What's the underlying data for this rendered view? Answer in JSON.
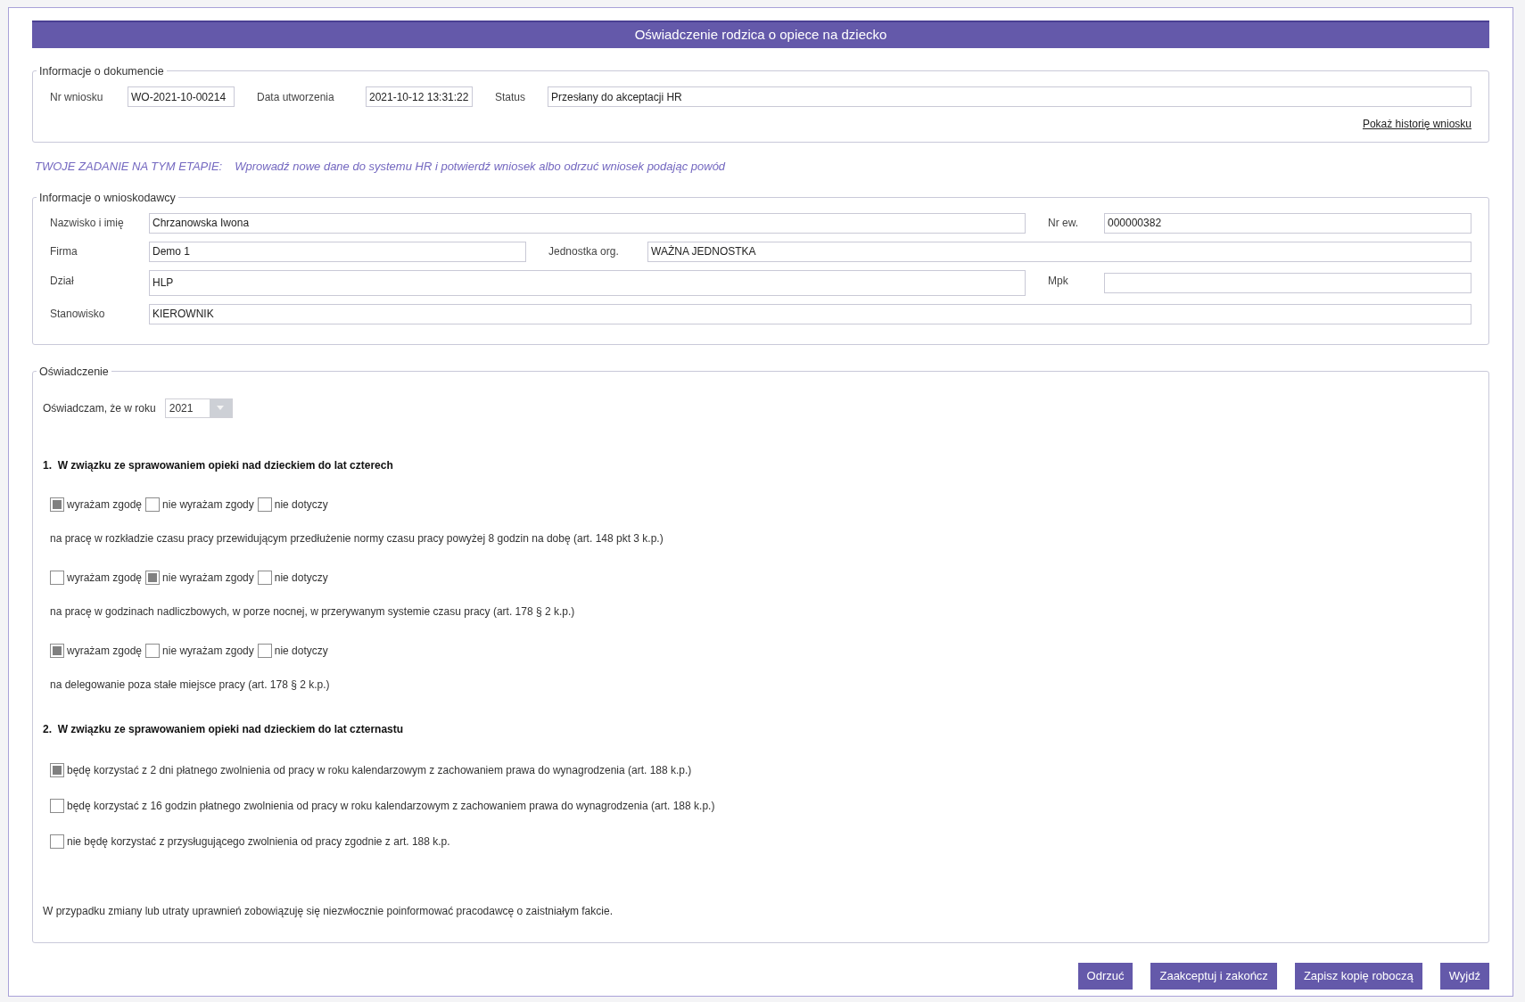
{
  "title": "Oświadczenie rodzica o opiece na dziecko",
  "document_info": {
    "legend": "Informacje o dokumencie",
    "fields": [
      {
        "label": "Nr wniosku",
        "value": "WO-2021-10-00214"
      },
      {
        "label": "Data utworzenia",
        "value": "2021-10-12 13:31:22"
      },
      {
        "label": "Status",
        "value": "Przesłany do akceptacji HR"
      }
    ],
    "history_link": "Pokaż historię wniosku"
  },
  "task": {
    "label": "TWOJE ZADANIE NA TYM ETAPIE:",
    "text": "Wprowadź nowe dane do systemu HR i potwierdź wniosek albo odrzuć wniosek podając powód"
  },
  "applicant": {
    "legend": "Informacje o wnioskodawcy",
    "fields": [
      {
        "label": "Nazwisko i imię",
        "value": "Chrzanowska Iwona"
      },
      {
        "label": "Nr ew.",
        "value": "000000382"
      },
      {
        "label": "Firma",
        "value": "Demo 1"
      },
      {
        "label": "Jednostka org.",
        "value": "WAŻNA JEDNOSTKA"
      },
      {
        "label": "Dział",
        "value": "HLP"
      },
      {
        "label": "Mpk"
      },
      {
        "label": "Stanowisko",
        "value": "KIEROWNIK"
      }
    ]
  },
  "declaration": {
    "legend": "Oświadczenie",
    "year_label": "Oświadczam, że w roku",
    "year": "2021",
    "section_1": {
      "heading": "1.  W związku ze sprawowaniem opieki nad dzieckiem do lat czterech",
      "items": [
        {
          "options": [
            {
              "label": "wyrażam zgodę",
              "checked": true
            },
            {
              "label": "nie wyrażam zgody",
              "checked": false
            },
            {
              "label": "nie dotyczy",
              "checked": false
            }
          ],
          "text": "na pracę w rozkładzie czasu pracy przewidującym przedłużenie normy czasu pracy powyżej 8 godzin na dobę (art. 148 pkt 3 k.p.)"
        },
        {
          "options": [
            {
              "label": "wyrażam zgodę",
              "checked": false
            },
            {
              "label": "nie wyrażam zgody",
              "checked": true
            },
            {
              "label": "nie dotyczy",
              "checked": false
            }
          ],
          "text": "na pracę w godzinach nadliczbowych, w porze nocnej, w przerywanym systemie czasu pracy (art. 178 § 2 k.p.)"
        },
        {
          "options": [
            {
              "label": "wyrażam zgodę",
              "checked": true
            },
            {
              "label": "nie wyrażam zgody",
              "checked": false
            },
            {
              "label": "nie dotyczy",
              "checked": false
            }
          ],
          "text": "na delegowanie poza stałe miejsce pracy (art. 178 § 2 k.p.)"
        }
      ]
    },
    "section_2": {
      "heading": "2.  W związku ze sprawowaniem opieki nad dzieckiem do lat czternastu",
      "options": [
        {
          "label": "będę korzystać z 2 dni płatnego zwolnienia od pracy w roku kalendarzowym z zachowaniem prawa do wynagrodzenia (art. 188 k.p.)",
          "checked": true
        },
        {
          "label": "będę korzystać z 16 godzin płatnego zwolnienia od pracy w roku kalendarzowym z zachowaniem prawa do wynagrodzenia (art. 188 k.p.)",
          "checked": false
        },
        {
          "label": "nie będę korzystać z przysługującego zwolnienia od pracy zgodnie z art. 188 k.p.",
          "checked": false
        }
      ]
    },
    "footer": "W przypadku zmiany lub utraty uprawnień zobowiązuję się niezwłocznie poinformować pracodawcę o zaistniałym fakcie."
  },
  "buttons": [
    "Odrzuć",
    "Zaakceptuj i zakończ",
    "Zapisz kopię roboczą",
    "Wyjdź"
  ]
}
